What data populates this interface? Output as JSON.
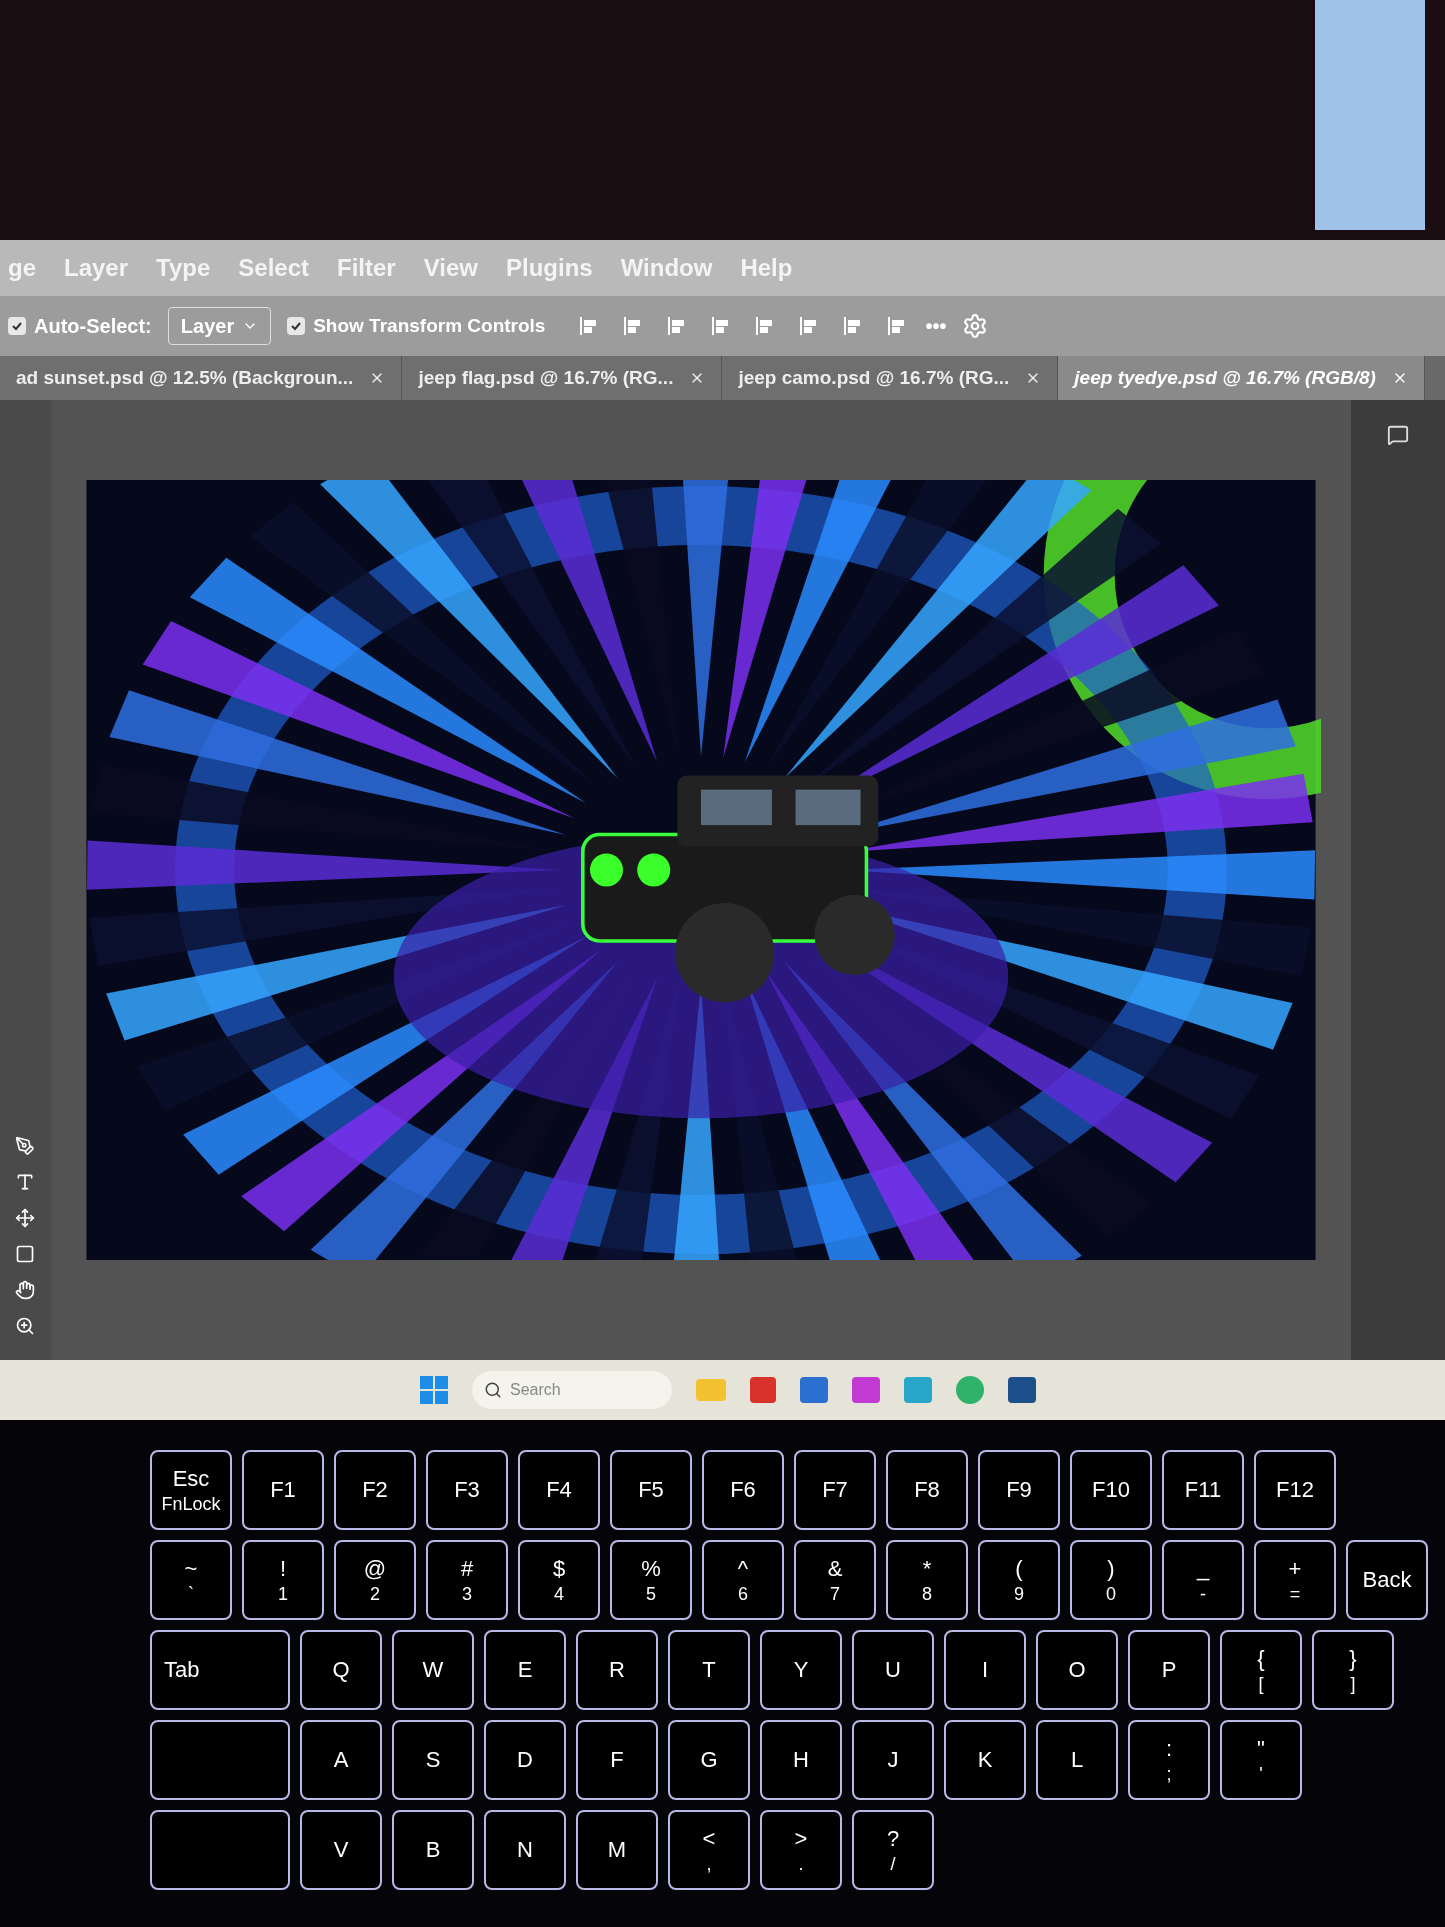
{
  "menu_bar": {
    "items": [
      "ge",
      "Layer",
      "Type",
      "Select",
      "Filter",
      "View",
      "Plugins",
      "Window",
      "Help"
    ]
  },
  "options_bar": {
    "auto_select": {
      "label": "Auto-Select:",
      "checked": true
    },
    "target": {
      "value": "Layer"
    },
    "transform_controls": {
      "label": "Show Transform Controls",
      "checked": true
    },
    "more": "•••"
  },
  "tabs": [
    {
      "label": "ad sunset.psd @ 12.5% (Backgroun...",
      "selected": false
    },
    {
      "label": "jeep flag.psd @ 16.7% (RG...",
      "selected": false
    },
    {
      "label": "jeep camo.psd @ 16.7% (RG...",
      "selected": false
    },
    {
      "label": "jeep tyedye.psd @ 16.7% (RGB/8)",
      "selected": true
    }
  ],
  "taskbar": {
    "search": {
      "placeholder": "Search"
    }
  },
  "keyboard": {
    "rows": [
      [
        {
          "kind": "normal",
          "lines": [
            "Esc",
            "FnLock"
          ]
        },
        {
          "kind": "normal",
          "lines": [
            "F1"
          ]
        },
        {
          "kind": "normal",
          "lines": [
            "F2"
          ]
        },
        {
          "kind": "normal",
          "lines": [
            "F3"
          ]
        },
        {
          "kind": "normal",
          "lines": [
            "F4"
          ]
        },
        {
          "kind": "normal",
          "lines": [
            "F5"
          ]
        },
        {
          "kind": "normal",
          "lines": [
            "F6"
          ]
        },
        {
          "kind": "normal",
          "lines": [
            "F7"
          ]
        },
        {
          "kind": "normal",
          "lines": [
            "F8"
          ]
        },
        {
          "kind": "normal",
          "lines": [
            "F9"
          ]
        },
        {
          "kind": "normal",
          "lines": [
            "F10"
          ]
        },
        {
          "kind": "normal",
          "lines": [
            "F11"
          ]
        },
        {
          "kind": "normal",
          "lines": [
            "F12"
          ]
        }
      ],
      [
        {
          "kind": "normal",
          "lines": [
            "~",
            "`"
          ]
        },
        {
          "kind": "normal",
          "lines": [
            "!",
            "1"
          ]
        },
        {
          "kind": "normal",
          "lines": [
            "@",
            "2"
          ]
        },
        {
          "kind": "normal",
          "lines": [
            "#",
            "3"
          ]
        },
        {
          "kind": "normal",
          "lines": [
            "$",
            "4"
          ]
        },
        {
          "kind": "normal",
          "lines": [
            "%",
            "5"
          ]
        },
        {
          "kind": "normal",
          "lines": [
            "^",
            "6"
          ]
        },
        {
          "kind": "normal",
          "lines": [
            "&",
            "7"
          ]
        },
        {
          "kind": "normal",
          "lines": [
            "*",
            "8"
          ]
        },
        {
          "kind": "normal",
          "lines": [
            "(",
            "9"
          ]
        },
        {
          "kind": "normal",
          "lines": [
            ")",
            "0"
          ]
        },
        {
          "kind": "normal",
          "lines": [
            "_",
            "-"
          ]
        },
        {
          "kind": "normal",
          "lines": [
            "+",
            "="
          ]
        },
        {
          "kind": "normal",
          "lines": [
            "Back"
          ]
        }
      ],
      [
        {
          "kind": "wide",
          "lines": [
            "Tab"
          ]
        },
        {
          "kind": "normal",
          "lines": [
            "Q"
          ]
        },
        {
          "kind": "normal",
          "lines": [
            "W"
          ]
        },
        {
          "kind": "normal",
          "lines": [
            "E"
          ]
        },
        {
          "kind": "normal",
          "lines": [
            "R"
          ]
        },
        {
          "kind": "normal",
          "lines": [
            "T"
          ]
        },
        {
          "kind": "normal",
          "lines": [
            "Y"
          ]
        },
        {
          "kind": "normal",
          "lines": [
            "U"
          ]
        },
        {
          "kind": "normal",
          "lines": [
            "I"
          ]
        },
        {
          "kind": "normal",
          "lines": [
            "O"
          ]
        },
        {
          "kind": "normal",
          "lines": [
            "P"
          ]
        },
        {
          "kind": "normal",
          "lines": [
            "{",
            "["
          ]
        },
        {
          "kind": "normal",
          "lines": [
            "}",
            "]"
          ]
        }
      ],
      [
        {
          "kind": "wide"
        },
        {
          "kind": "normal",
          "lines": [
            "A"
          ]
        },
        {
          "kind": "normal",
          "lines": [
            "S"
          ]
        },
        {
          "kind": "normal",
          "lines": [
            "D"
          ]
        },
        {
          "kind": "normal",
          "lines": [
            "F"
          ]
        },
        {
          "kind": "normal",
          "lines": [
            "G"
          ]
        },
        {
          "kind": "normal",
          "lines": [
            "H"
          ]
        },
        {
          "kind": "normal",
          "lines": [
            "J"
          ]
        },
        {
          "kind": "normal",
          "lines": [
            "K"
          ]
        },
        {
          "kind": "normal",
          "lines": [
            "L"
          ]
        },
        {
          "kind": "normal",
          "lines": [
            ":",
            ";"
          ]
        },
        {
          "kind": "normal",
          "lines": [
            "\"",
            "'"
          ]
        }
      ],
      [
        {
          "kind": "wide"
        },
        {
          "kind": "normal",
          "lines": [
            "V"
          ]
        },
        {
          "kind": "normal",
          "lines": [
            "B"
          ]
        },
        {
          "kind": "normal",
          "lines": [
            "N"
          ]
        },
        {
          "kind": "normal",
          "lines": [
            "M"
          ]
        },
        {
          "kind": "normal",
          "lines": [
            "<",
            ","
          ]
        },
        {
          "kind": "normal",
          "lines": [
            ">",
            "."
          ]
        },
        {
          "kind": "normal",
          "lines": [
            "?",
            "/"
          ]
        }
      ]
    ]
  }
}
